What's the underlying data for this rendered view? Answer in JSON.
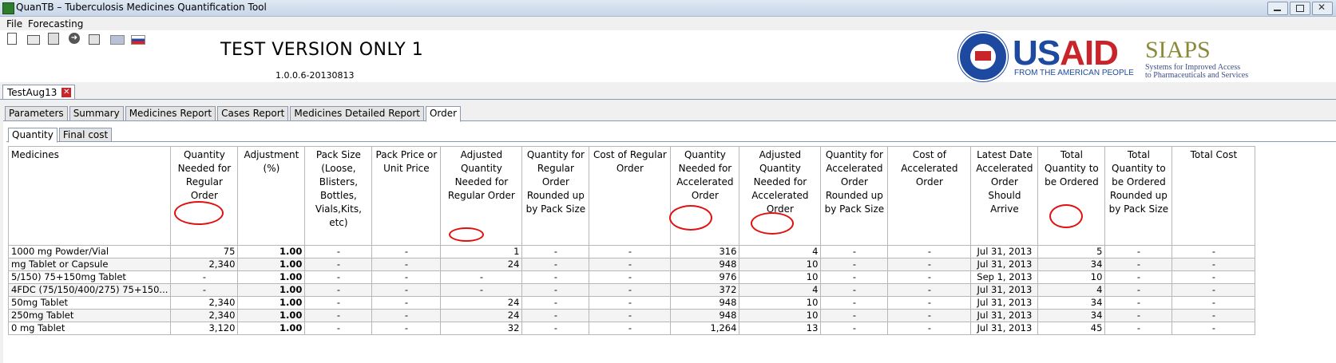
{
  "window": {
    "title": "QuanTB – Tuberculosis Medicines Quantification Tool"
  },
  "menu": [
    "File",
    "Forecasting"
  ],
  "header": {
    "test_version": "TEST VERSION ONLY 1",
    "version": "1.0.0.6-20130813",
    "usaid": {
      "us": "US",
      "aid": "AID",
      "sub": "FROM THE AMERICAN PEOPLE"
    },
    "siaps": {
      "name": "SIAPS",
      "sub1": "Systems for Improved Access",
      "sub2": "to Pharmaceuticals and Services"
    }
  },
  "document_tab": "TestAug13",
  "tabs": [
    "Parameters",
    "Summary",
    "Medicines Report",
    "Cases Report",
    "Medicines Detailed Report",
    "Order"
  ],
  "active_tab": "Order",
  "subtabs": [
    "Quantity",
    "Final cost"
  ],
  "table": {
    "columns": [
      "Medicines",
      "Quantity Needed for Regular Order",
      "Adjustment (%)",
      "Pack Size (Loose, Blisters, Bottles, Vials,Kits, etc)",
      "Pack Price or Unit Price",
      "Adjusted Quantity Needed for Regular Order",
      "Quantity for Regular Order Rounded up by Pack Size",
      "Cost of Regular Order",
      "Quantity Needed for Accelerated Order",
      "Adjusted Quantity Needed for Accelerated Order",
      "Quantity for Accelerated Order Rounded up by Pack Size",
      "Cost of Accelerated Order",
      "Latest Date Accelerated Order Should Arrive",
      "Total Quantity to be Ordered",
      "Total Quantity to be Ordered Rounded up by Pack Size",
      "Total Cost"
    ],
    "rows": [
      [
        "1000 mg  Powder/Vial",
        "75",
        "1.00",
        "-",
        "-",
        "1",
        "-",
        "-",
        "316",
        "4",
        "-",
        "-",
        "Jul 31, 2013",
        "5",
        "-",
        "-"
      ],
      [
        " mg  Tablet or Capsule",
        "2,340",
        "1.00",
        "-",
        "-",
        "24",
        "-",
        "-",
        "948",
        "10",
        "-",
        "-",
        "Jul 31, 2013",
        "34",
        "-",
        "-"
      ],
      [
        "5/150)  75+150mg  Tablet",
        "-",
        "1.00",
        "-",
        "-",
        "-",
        "-",
        "-",
        "976",
        "10",
        "-",
        "-",
        "Sep 1, 2013",
        "10",
        "-",
        "-"
      ],
      [
        "4FDC (75/150/400/275)  75+150...",
        "-",
        "1.00",
        "-",
        "-",
        "-",
        "-",
        "-",
        "372",
        "4",
        "-",
        "-",
        "Jul 31, 2013",
        "4",
        "-",
        "-"
      ],
      [
        "50mg  Tablet",
        "2,340",
        "1.00",
        "-",
        "-",
        "24",
        "-",
        "-",
        "948",
        "10",
        "-",
        "-",
        "Jul 31, 2013",
        "34",
        "-",
        "-"
      ],
      [
        "  250mg  Tablet",
        "2,340",
        "1.00",
        "-",
        "-",
        "24",
        "-",
        "-",
        "948",
        "10",
        "-",
        "-",
        "Jul 31, 2013",
        "34",
        "-",
        "-"
      ],
      [
        "0 mg  Tablet",
        "3,120",
        "1.00",
        "-",
        "-",
        "32",
        "-",
        "-",
        "1,264",
        "13",
        "-",
        "-",
        "Jul 31, 2013",
        "45",
        "-",
        "-"
      ]
    ]
  }
}
